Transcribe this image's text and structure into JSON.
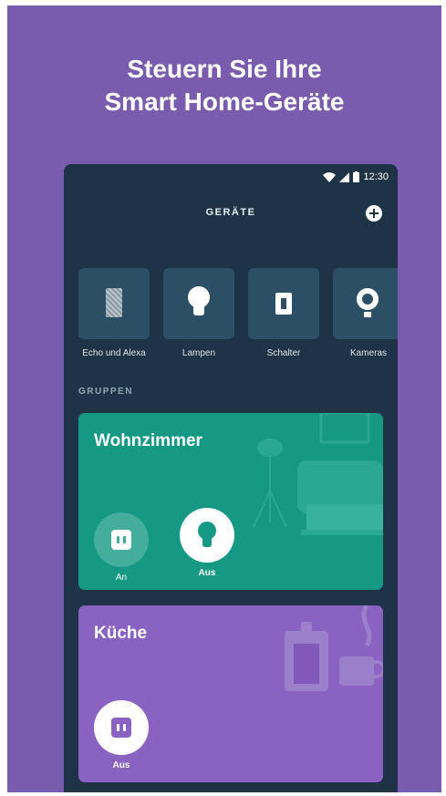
{
  "headline": {
    "line1": "Steuern Sie Ihre",
    "line2": "Smart Home-Geräte"
  },
  "status_bar": {
    "time": "12:30"
  },
  "header": {
    "title": "GERÄTE"
  },
  "categories": [
    {
      "label": "Echo und Alexa",
      "icon": "echo-speaker-icon"
    },
    {
      "label": "Lampen",
      "icon": "light-bulb-icon"
    },
    {
      "label": "Schalter",
      "icon": "light-switch-icon"
    },
    {
      "label": "Kameras",
      "icon": "camera-icon"
    }
  ],
  "groups_heading": "GRUPPEN",
  "groups": [
    {
      "name": "Wohnzimmer",
      "controls": [
        {
          "state": "An",
          "icon": "plug-icon"
        },
        {
          "state": "Aus",
          "icon": "light-bulb-icon"
        }
      ]
    },
    {
      "name": "Küche",
      "controls": [
        {
          "state": "Aus",
          "icon": "plug-icon"
        }
      ]
    }
  ],
  "colors": {
    "background": "#7a5cae",
    "phone": "#1e3346",
    "tile": "#2c4f66",
    "living_room_card": "#159884",
    "kitchen_card": "#8a63c2"
  }
}
